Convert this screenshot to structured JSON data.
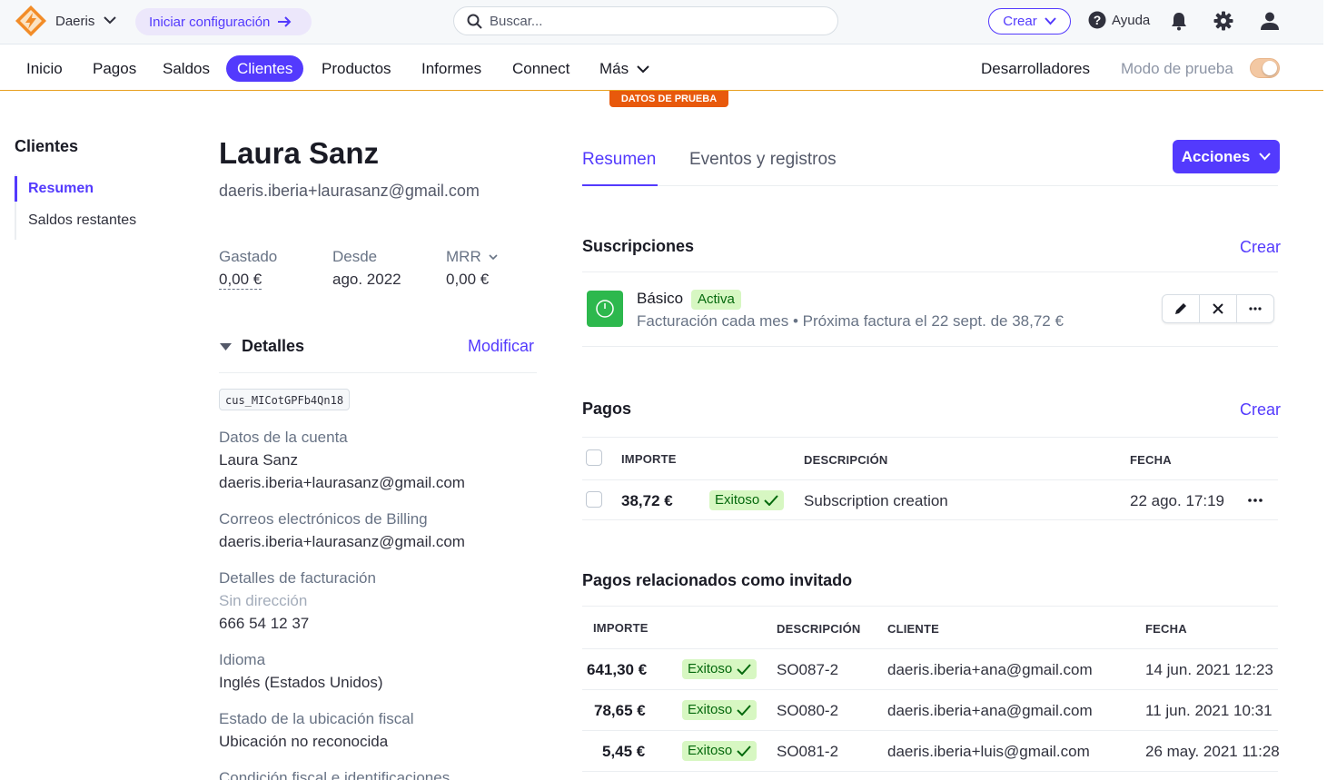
{
  "topbar": {
    "account_name": "Daeris",
    "setup_label": "Iniciar configuración",
    "search_placeholder": "Buscar...",
    "create_label": "Crear",
    "help_label": "Ayuda"
  },
  "nav": {
    "items": [
      "Inicio",
      "Pagos",
      "Saldos",
      "Clientes",
      "Productos",
      "Informes",
      "Connect",
      "Más"
    ],
    "active": "Clientes",
    "developers": "Desarrolladores",
    "test_mode": "Modo de prueba",
    "test_data_badge": "DATOS DE PRUEBA"
  },
  "sidebar": {
    "title": "Clientes",
    "items": [
      "Resumen",
      "Saldos restantes"
    ]
  },
  "customer": {
    "name": "Laura Sanz",
    "email": "daeris.iberia+laurasanz@gmail.com",
    "stats": [
      {
        "label": "Gastado",
        "value": "0,00 €"
      },
      {
        "label": "Desde",
        "value": "ago. 2022"
      },
      {
        "label": "MRR",
        "value": "0,00 €"
      }
    ],
    "details_title": "Detalles",
    "modify_label": "Modificar",
    "id": "cus_MICotGPFb4Qn18",
    "account_label": "Datos de la cuenta",
    "account_name": "Laura Sanz",
    "account_email": "daeris.iberia+laurasanz@gmail.com",
    "billing_emails_label": "Correos electrónicos de Billing",
    "billing_email": "daeris.iberia+laurasanz@gmail.com",
    "billing_details_label": "Detalles de facturación",
    "no_address": "Sin dirección",
    "phone": "666 54 12 37",
    "language_label": "Idioma",
    "language": "Inglés (Estados Unidos)",
    "tax_location_label": "Estado de la ubicación fiscal",
    "tax_location": "Ubicación no reconocida",
    "tax_status_label": "Condición fiscal e identificaciones"
  },
  "tabs": [
    "Resumen",
    "Eventos y registros"
  ],
  "actions_label": "Acciones",
  "subscriptions": {
    "title": "Suscripciones",
    "create": "Crear",
    "item": {
      "name": "Básico",
      "status": "Activa",
      "description": "Facturación cada mes • Próxima factura el 22 sept. de 38,72 €"
    }
  },
  "payments": {
    "title": "Pagos",
    "create": "Crear",
    "headers": [
      "IMPORTE",
      "DESCRIPCIÓN",
      "FECHA"
    ],
    "rows": [
      {
        "amount": "38,72 €",
        "status": "Exitoso",
        "description": "Subscription creation",
        "date": "22 ago. 17:19"
      }
    ]
  },
  "guest_payments": {
    "title": "Pagos relacionados como invitado",
    "headers": [
      "IMPORTE",
      "DESCRIPCIÓN",
      "CLIENTE",
      "FECHA"
    ],
    "rows": [
      {
        "amount": "641,30 €",
        "status": "Exitoso",
        "description": "SO087-2",
        "customer": "daeris.iberia+ana@gmail.com",
        "date": "14 jun. 2021 12:23"
      },
      {
        "amount": "78,65 €",
        "status": "Exitoso",
        "description": "SO080-2",
        "customer": "daeris.iberia+ana@gmail.com",
        "date": "11 jun. 2021 10:31"
      },
      {
        "amount": "5,45 €",
        "status": "Exitoso",
        "description": "SO081-2",
        "customer": "daeris.iberia+luis@gmail.com",
        "date": "26 may. 2021 11:28"
      }
    ]
  },
  "colors": {
    "accent": "#533afd",
    "success_bg": "#d7f7c2",
    "success_text": "#05690d",
    "test_badge": "#e8590c"
  }
}
